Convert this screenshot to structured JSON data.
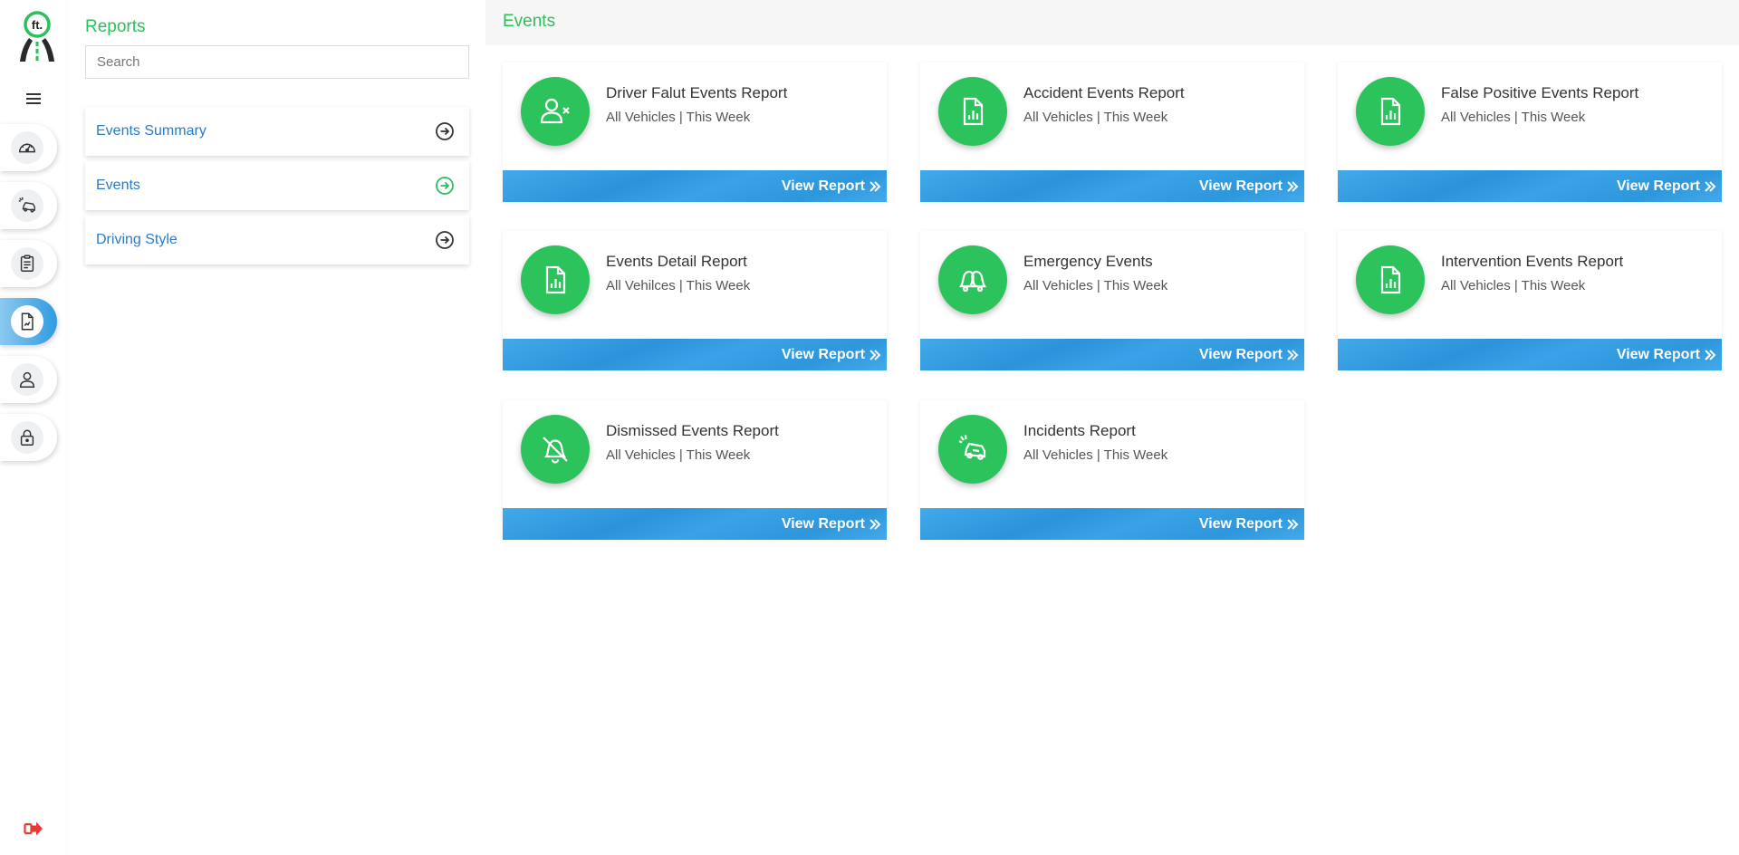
{
  "sidebar": {
    "panel_title": "Reports",
    "search_placeholder": "Search",
    "items": [
      {
        "label": "Events Summary",
        "icon": "arrow-circle-right-icon",
        "color": "#333333"
      },
      {
        "label": "Events",
        "icon": "arrow-circle-right-icon",
        "color": "#2cbf5a"
      },
      {
        "label": "Driving Style",
        "icon": "arrow-circle-right-icon",
        "color": "#333333"
      }
    ]
  },
  "rail": {
    "icons": [
      "dashboard-gauge-icon",
      "car-crash-icon",
      "clipboard-icon",
      "report-document-icon",
      "user-icon",
      "lock-icon"
    ],
    "active": "report-document-icon",
    "logout_icon": "logout-icon"
  },
  "main": {
    "title": "Events",
    "cards": [
      {
        "title": "Driver Falut Events Report",
        "subtitle": "All Vehicles | This Week",
        "button": "View Report",
        "icon": "user-x-icon"
      },
      {
        "title": "Accident Events Report",
        "subtitle": "All Vehicles | This Week",
        "button": "View Report",
        "icon": "file-chart-icon"
      },
      {
        "title": "False Positive Events Report",
        "subtitle": "All Vehicles | This Week",
        "button": "View Report",
        "icon": "file-chart-icon"
      },
      {
        "title": "Events Detail Report",
        "subtitle": "All Vehilces | This Week",
        "button": "View Report",
        "icon": "file-chart-icon"
      },
      {
        "title": "Emergency Events",
        "subtitle": "All Vehicles | This Week",
        "button": "View Report",
        "icon": "bells-icon"
      },
      {
        "title": "Intervention Events Report",
        "subtitle": "All Vehicles | This Week",
        "button": "View Report",
        "icon": "file-chart-icon"
      },
      {
        "title": "Dismissed Events Report",
        "subtitle": "All Vehicles | This Week",
        "button": "View Report",
        "icon": "bell-off-icon"
      },
      {
        "title": "Incidents Report",
        "subtitle": "All Vehicles | This Week",
        "button": "View Report",
        "icon": "car-crash-icon"
      }
    ]
  },
  "colors": {
    "accent_green": "#2cc35d",
    "link_blue": "#2a7cc7",
    "button_blue": "#3aa2e6",
    "logout_red": "#e53935"
  }
}
